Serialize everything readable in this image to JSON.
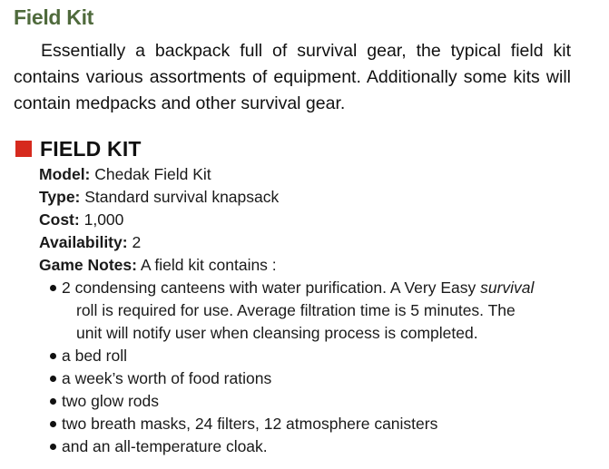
{
  "section": {
    "title": "Field Kit",
    "intro": "Essentially a backpack full of survival gear, the typical field kit contains various assortments of equipment. Additionally some kits will contain medpacks and other survival gear."
  },
  "item": {
    "title": "FIELD KIT",
    "accent_color": "#d62a1e",
    "stats": [
      {
        "label": "Model:",
        "value": "Chedak Field Kit"
      },
      {
        "label": "Type:",
        "value": "Standard survival knapsack"
      },
      {
        "label": "Cost:",
        "value": "1,000"
      },
      {
        "label": "Availability:",
        "value": "2"
      },
      {
        "label": "Game Notes:",
        "value": "A field kit contains :"
      }
    ],
    "contents": {
      "first": {
        "before": "2 condensing canteens with water purification. A Very Easy ",
        "emphasis": "survival",
        "line2": "roll is required for use. Average filtration time is 5 minutes. The",
        "line3": "unit will notify user when cleansing process is completed."
      },
      "rest": [
        "a bed roll",
        "a week’s worth of food rations",
        "two glow rods",
        "two breath masks, 24 filters, 12 atmosphere canisters",
        "and an all-temperature cloak."
      ]
    }
  }
}
